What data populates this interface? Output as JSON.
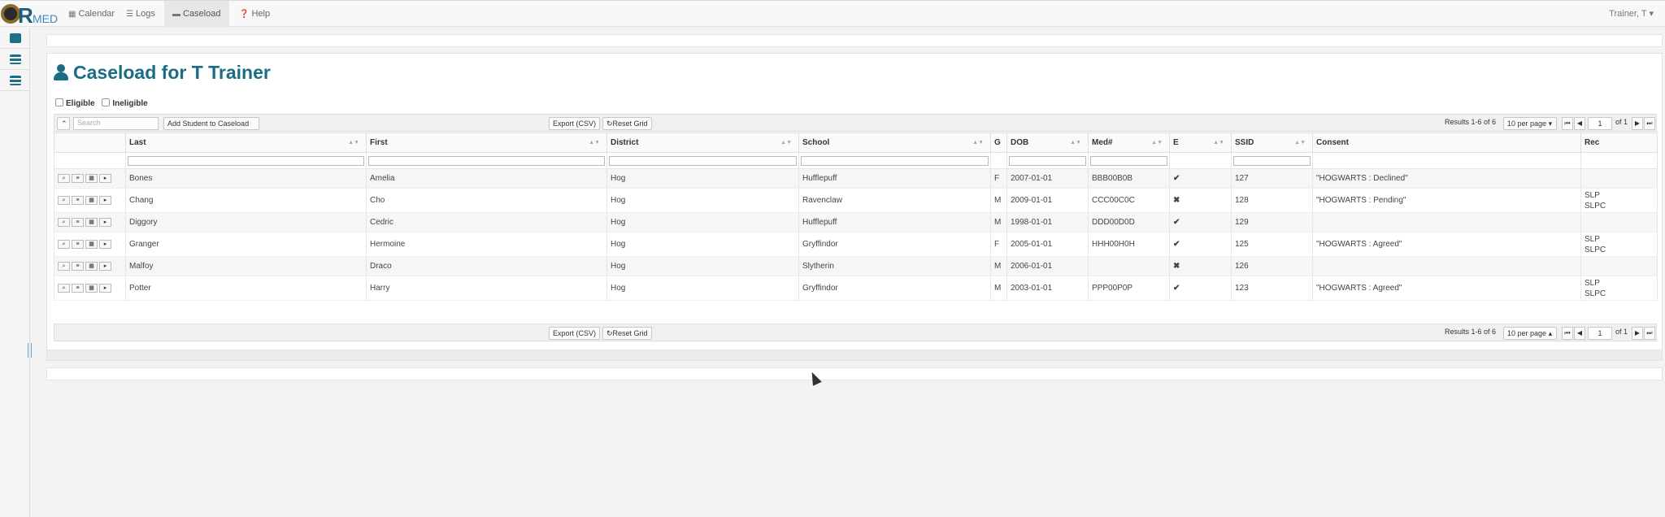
{
  "nav": {
    "logo_r": "R",
    "logo_med": "MED",
    "items": [
      {
        "label": "Calendar",
        "icon": "calendar-icon"
      },
      {
        "label": "Logs",
        "icon": "list-icon"
      },
      {
        "label": "Caseload",
        "icon": "caseload-icon"
      },
      {
        "label": "Help",
        "icon": "question-icon"
      }
    ],
    "active": "Caseload",
    "user": "Trainer, T ▾"
  },
  "page": {
    "title": "Caseload for T Trainer",
    "filters": [
      {
        "label": "Eligible"
      },
      {
        "label": "Ineligible"
      }
    ]
  },
  "toolbar": {
    "search_placeholder": "Search",
    "add_student": "Add Student to Caseload",
    "export": "Export (CSV)",
    "reset": "Reset Grid",
    "results": "Results 1-6 of 6",
    "per_page": "10 per page",
    "page": "1",
    "of_pages": "of 1"
  },
  "grid": {
    "columns": [
      "",
      "Last",
      "First",
      "District",
      "School",
      "G",
      "DOB",
      "Med#",
      "E",
      "SSID",
      "Consent",
      "Rec"
    ],
    "rows": [
      {
        "last": "Bones",
        "first": "Amelia",
        "district": "Hog",
        "school": "Hufflepuff",
        "g": "F",
        "dob": "2007-01-01",
        "med": "BBB00B0B",
        "e": "✔",
        "ssid": "127",
        "consent": "\"HOGWARTS : Declined\"",
        "rec1": "",
        "rec2": ""
      },
      {
        "last": "Chang",
        "first": "Cho",
        "district": "Hog",
        "school": "Ravenclaw",
        "g": "M",
        "dob": "2009-01-01",
        "med": "CCC00C0C",
        "e": "✖",
        "ssid": "128",
        "consent": "\"HOGWARTS : Pending\"",
        "rec1": "SLP",
        "rec2": "SLPC"
      },
      {
        "last": "Diggory",
        "first": "Cedric",
        "district": "Hog",
        "school": "Hufflepuff",
        "g": "M",
        "dob": "1998-01-01",
        "med": "DDD00D0D",
        "e": "✔",
        "ssid": "129",
        "consent": "",
        "rec1": "",
        "rec2": ""
      },
      {
        "last": "Granger",
        "first": "Hermoine",
        "district": "Hog",
        "school": "Gryffindor",
        "g": "F",
        "dob": "2005-01-01",
        "med": "HHH00H0H",
        "e": "✔",
        "ssid": "125",
        "consent": "\"HOGWARTS : Agreed\"",
        "rec1": "SLP",
        "rec2": "SLPC"
      },
      {
        "last": "Malfoy",
        "first": "Draco",
        "district": "Hog",
        "school": "Slytherin",
        "g": "M",
        "dob": "2006-01-01",
        "med": "",
        "e": "✖",
        "ssid": "126",
        "consent": "",
        "rec1": "",
        "rec2": ""
      },
      {
        "last": "Potter",
        "first": "Harry",
        "district": "Hog",
        "school": "Gryffindor",
        "g": "M",
        "dob": "2003-01-01",
        "med": "PPP00P0P",
        "e": "✔",
        "ssid": "123",
        "consent": "\"HOGWARTS : Agreed\"",
        "rec1": "SLP",
        "rec2": "SLPC"
      }
    ]
  },
  "colors": {
    "accent": "#1b6d86",
    "check": "#5a9a3a",
    "x": "#c0392b"
  }
}
